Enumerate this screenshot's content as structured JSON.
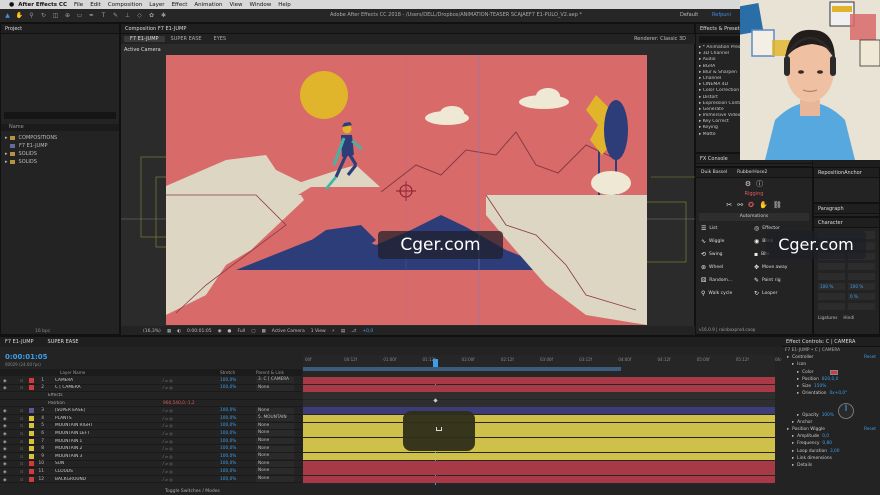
{
  "menubar": {
    "apple": "",
    "app": "After Effects CC",
    "items": [
      "File",
      "Edit",
      "Composition",
      "Layer",
      "Effect",
      "Animation",
      "View",
      "Window",
      "Help"
    ]
  },
  "toolbar": {
    "title": "Adobe After Effects CC 2018 - /Users/DELL/Dropbox/ANIMATION-TEASER SCAJAEF7 E1-PULO_V2.aep *",
    "workspace_default": "Default",
    "workspace_active": "Refpuni"
  },
  "project": {
    "title": "Project",
    "column_name": "Name",
    "items": [
      {
        "type": "folder",
        "name": "COMPOSITIONS"
      },
      {
        "type": "comp",
        "name": "F7 E1-JUMP"
      },
      {
        "type": "folder",
        "name": "SOLIDS"
      },
      {
        "type": "folder",
        "name": "SOLIDS"
      }
    ],
    "bpc": "16 bpc"
  },
  "composition": {
    "title": "Composition F7 E1-JUMP",
    "tabs": [
      "F7 E1-JUMP",
      "SUPER EASE",
      "EYES"
    ],
    "renderer_label": "Renderer:",
    "renderer_value": "Classic 3D",
    "active_camera_label": "Active Camera",
    "viewbar": {
      "zoom": "(16,3%)",
      "time": "0:00:01:05",
      "resolution": "Full",
      "camera": "Active Camera",
      "views": "1 View",
      "offset": "+0,0"
    }
  },
  "effects_panel": {
    "title": "Effects & Presets",
    "items": [
      "* Animation Presets",
      "3D Channel",
      "Audio",
      "BGRA",
      "Blur & Sharpen",
      "Channel",
      "CINEMA 4D",
      "Color Correction",
      "Distort",
      "Expression Controls",
      "Generate",
      "Immersive Video",
      "Key Correct",
      "Keying",
      "Matte"
    ]
  },
  "fx_console": {
    "title": "FX Console"
  },
  "duik": {
    "tabs": [
      "Duik Bassel",
      "RubberHose2"
    ],
    "rigging": "Rigging",
    "automations": "Automations",
    "buttons": [
      "List",
      "Effector",
      "Wiggle",
      "Blink",
      "Swing",
      "Bits",
      "Wheel",
      "Move away",
      "Random...",
      "Paint rig",
      "Walk cycle",
      "Looper"
    ],
    "version": "v16.0.9 | rainboxprod.coop"
  },
  "right_panels": {
    "reposition": "RepositionAnchor",
    "paragraph": "Paragraph",
    "character": "Character",
    "font_size": "100 %",
    "tracking": "0 %",
    "ligatures": "Ligatures",
    "hindi": "Hindi"
  },
  "timeline": {
    "tabs": [
      "F7 E1-JUMP",
      "SUPER EASE"
    ],
    "timecode": "0:00:01:05",
    "fps": "00029 (24.00 fps)",
    "col_layer": "Layer Name",
    "col_stretch": "Stretch",
    "col_parent": "Parent & Link",
    "toggle": "Toggle Switches / Modes",
    "ruler": [
      "00f",
      "00:12f",
      "01:00f",
      "01:12f",
      "02:00f",
      "02:12f",
      "03:00f",
      "03:12f",
      "04:00f",
      "04:12f",
      "05:00f",
      "05:12f",
      "06:0"
    ],
    "layers": [
      {
        "num": "1",
        "name": "CAMERA",
        "stretch": "100,0%",
        "parent": "3. C [ CAMERA",
        "color": "#d23b3b",
        "sub": false
      },
      {
        "num": "2",
        "name": "C [ CAMERA",
        "stretch": "100,0%",
        "parent": "None",
        "color": "#d23b3b",
        "sub": false
      },
      {
        "num": "",
        "name": "Effects",
        "stretch": "",
        "parent": "",
        "color": "",
        "sub": true
      },
      {
        "num": "",
        "name": "Position",
        "stretch": "",
        "parent": "",
        "color": "",
        "sub": true,
        "val": "960,540,0,-1,2"
      },
      {
        "num": "3",
        "name": "[SUPER EASE]",
        "stretch": "100,0%",
        "parent": "None",
        "color": "#5a5a9a",
        "sub": false
      },
      {
        "num": "4",
        "name": "PLANTS",
        "stretch": "100,0%",
        "parent": "5. MOUNTAIN",
        "color": "#d8c23a",
        "sub": false
      },
      {
        "num": "5",
        "name": "MOUNTAIN RIGHT",
        "stretch": "100,0%",
        "parent": "None",
        "color": "#d8c23a",
        "sub": false
      },
      {
        "num": "6",
        "name": "MOUNTAIN LEFT",
        "stretch": "100,0%",
        "parent": "None",
        "color": "#d8c23a",
        "sub": false
      },
      {
        "num": "7",
        "name": "MOUNTAIN 1",
        "stretch": "100,0%",
        "parent": "None",
        "color": "#d8c23a",
        "sub": false
      },
      {
        "num": "8",
        "name": "MOUNTAIN 2",
        "stretch": "100,0%",
        "parent": "None",
        "color": "#d8c23a",
        "sub": false
      },
      {
        "num": "9",
        "name": "MOUNTAIN 3",
        "stretch": "100,0%",
        "parent": "None",
        "color": "#d8c23a",
        "sub": false
      },
      {
        "num": "10",
        "name": "SUN",
        "stretch": "100,0%",
        "parent": "None",
        "color": "#d23b3b",
        "sub": false
      },
      {
        "num": "11",
        "name": "CLOUDS",
        "stretch": "100,0%",
        "parent": "None",
        "color": "#d23b3b",
        "sub": false
      },
      {
        "num": "12",
        "name": "BACKGROUND",
        "stretch": "100,0%",
        "parent": "None",
        "color": "#d23b3b",
        "sub": false
      }
    ]
  },
  "effect_controls": {
    "title": "Effect Controls: C | CAMERA",
    "layer": "F7 E1-JUMP • C | CAMERA",
    "rows": [
      {
        "label": "Controller",
        "value": "",
        "reset": "Reset",
        "indent": 1
      },
      {
        "label": "Icon",
        "value": "",
        "reset": "",
        "indent": 2
      },
      {
        "label": "Color",
        "value": "",
        "reset": "",
        "indent": 3
      },
      {
        "label": "Position",
        "value": "820,0,0",
        "reset": "",
        "indent": 3
      },
      {
        "label": "Size",
        "value": "150%",
        "reset": "",
        "indent": 3
      },
      {
        "label": "Orientation",
        "value": "0x+0,0°",
        "reset": "",
        "indent": 3
      },
      {
        "label": "",
        "value": "",
        "reset": "",
        "indent": 3
      },
      {
        "label": "",
        "value": "",
        "reset": "",
        "indent": 3
      },
      {
        "label": "Opacity",
        "value": "100%",
        "reset": "",
        "indent": 3
      },
      {
        "label": "Anchor",
        "value": "",
        "reset": "",
        "indent": 2
      },
      {
        "label": "Position Wiggle",
        "value": "",
        "reset": "Reset",
        "indent": 1
      },
      {
        "label": "Amplitude",
        "value": "0,0",
        "reset": "",
        "indent": 2
      },
      {
        "label": "Frequency",
        "value": "0,80",
        "reset": "",
        "indent": 2
      },
      {
        "label": "Loop duration",
        "value": "3,00",
        "reset": "",
        "indent": 2
      },
      {
        "label": "Link dimensions",
        "value": "",
        "reset": "",
        "indent": 2
      },
      {
        "label": "Details",
        "value": "",
        "reset": "",
        "indent": 2
      }
    ]
  },
  "watermarks": [
    "Cger.com",
    "Cger.com"
  ],
  "colors": {
    "sky": "#d96a6a",
    "sun": "#e0b52b",
    "mountain_light": "#dcd6c2",
    "mountain_dark": "#2c3d7a",
    "accent_blue": "#3d9ee8"
  }
}
